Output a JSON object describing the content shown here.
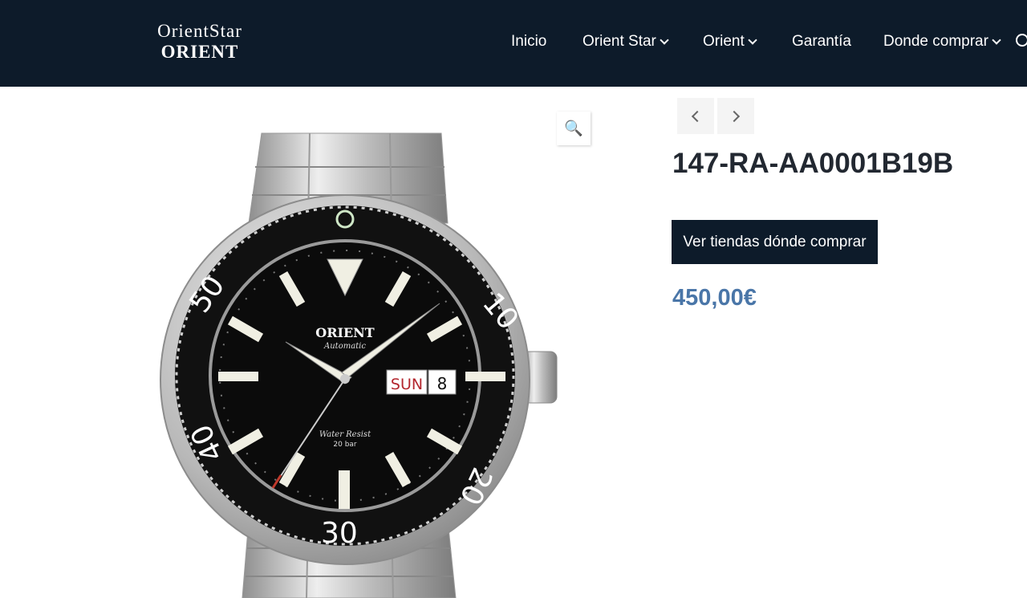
{
  "header": {
    "logo_top": "OrientStar",
    "logo_bottom": "ORIENT",
    "nav": [
      {
        "label": "Inicio",
        "has_dropdown": false
      },
      {
        "label": "Orient Star",
        "has_dropdown": true
      },
      {
        "label": "Orient",
        "has_dropdown": true
      },
      {
        "label": "Garantía",
        "has_dropdown": false
      },
      {
        "label": "Donde comprar",
        "has_dropdown": true
      }
    ],
    "search_icon": "search-icon"
  },
  "product": {
    "title": "147-RA-AA0001B19B",
    "buy_label": "Ver tiendas dónde comprar",
    "price": "450,00€",
    "zoom_icon": "🔍",
    "watch": {
      "brand": "ORIENT",
      "sub": "Automatic",
      "water": "Water Resist",
      "bar": "20 bar",
      "day": "SUN",
      "date": "8",
      "bezel": [
        "10",
        "20",
        "30",
        "40",
        "50"
      ]
    }
  },
  "colors": {
    "header_bg": "#0d1b2a",
    "price": "#4a76a8",
    "title": "#222831"
  }
}
